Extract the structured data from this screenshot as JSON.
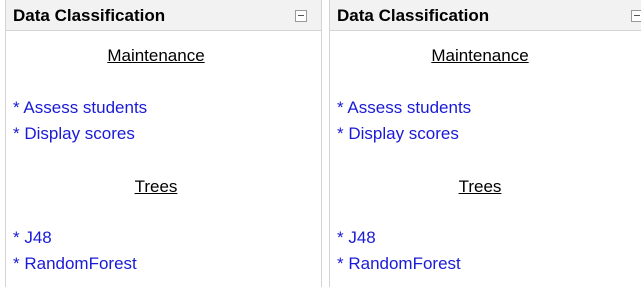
{
  "blocks": [
    {
      "title": "Data Classification",
      "sections": [
        {
          "heading": "Maintenance",
          "links": [
            "* Assess students",
            "* Display scores"
          ]
        },
        {
          "heading": "Trees",
          "links": [
            "* J48",
            "* RandomForest"
          ]
        }
      ]
    },
    {
      "title": "Data Classification",
      "sections": [
        {
          "heading": "Maintenance",
          "links": [
            "* Assess students",
            "* Display scores"
          ]
        },
        {
          "heading": "Trees",
          "links": [
            "* J48",
            "* RandomForest"
          ]
        }
      ]
    }
  ],
  "colors": {
    "header_bg": "#f2f2f2",
    "border": "#d4d4d4",
    "link": "#1a1ad6"
  },
  "icons": {
    "collapse": "minus-square-icon"
  }
}
